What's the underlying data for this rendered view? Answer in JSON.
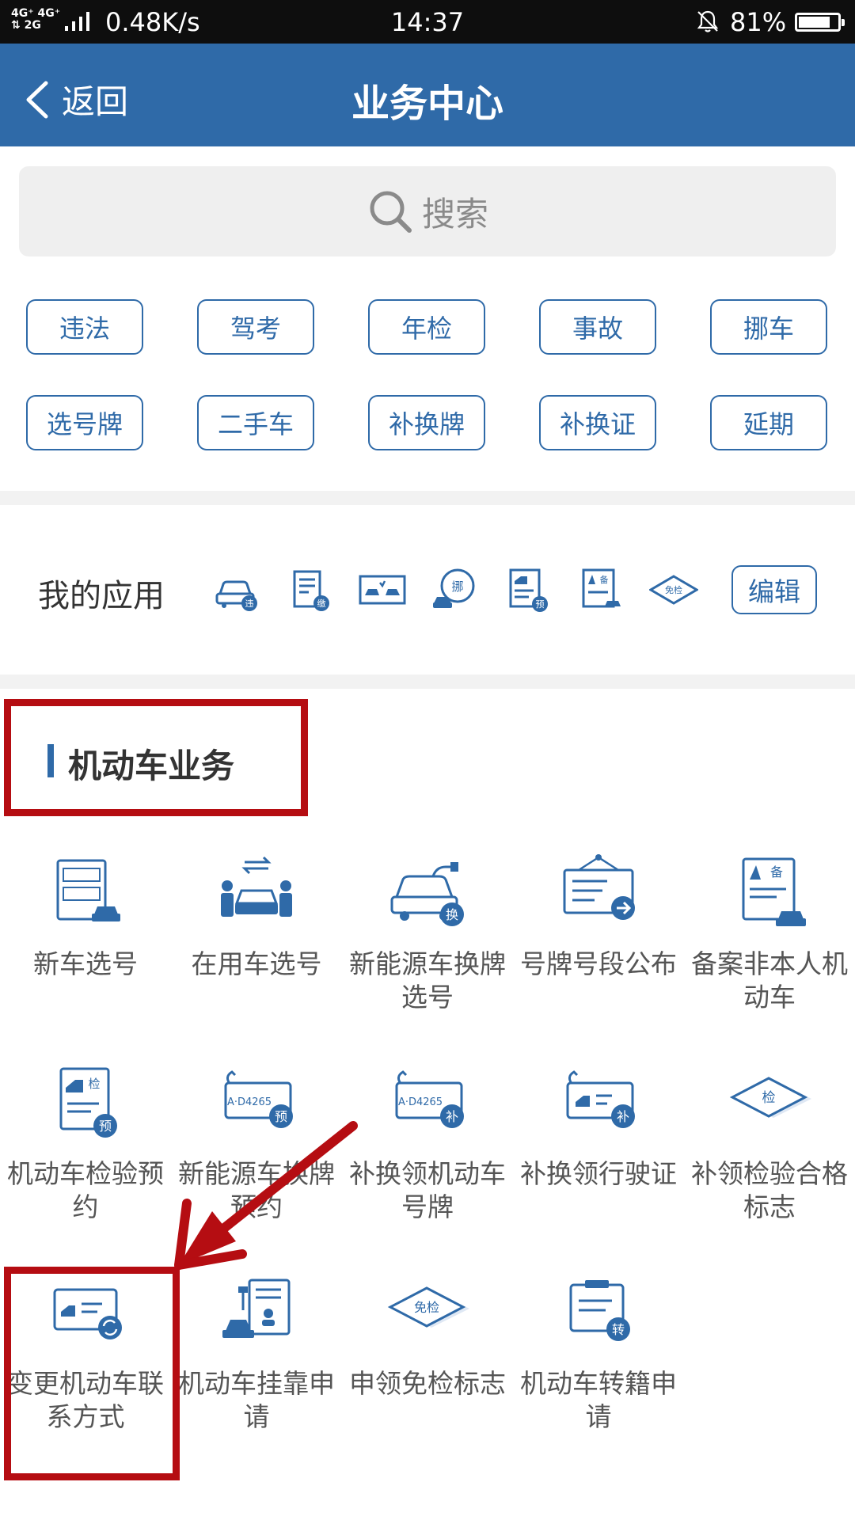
{
  "status_bar": {
    "network_top": "4G⁺ 4G⁺",
    "network_bottom": "⇅ 2G",
    "speed": "0.48K/s",
    "time": "14:37",
    "battery_percent": "81%",
    "battery_level": 0.81
  },
  "header": {
    "back_label": "返回",
    "title": "业务中心"
  },
  "search": {
    "placeholder": "搜索"
  },
  "tags": [
    "违法",
    "驾考",
    "年检",
    "事故",
    "挪车",
    "选号牌",
    "二手车",
    "补换牌",
    "补换证",
    "延期"
  ],
  "my_apps": {
    "label": "我的应用",
    "icons": [
      {
        "name": "car-violation-icon",
        "badge": "违"
      },
      {
        "name": "document-pay-icon",
        "badge": "缴"
      },
      {
        "name": "accident-scene-icon",
        "badge": ""
      },
      {
        "name": "move-car-icon",
        "badge": "挪"
      },
      {
        "name": "inspection-booking-icon",
        "badge": "预"
      },
      {
        "name": "filing-icon",
        "badge": "备"
      },
      {
        "name": "exempt-icon",
        "badge": "免检"
      }
    ],
    "edit_label": "编辑"
  },
  "section": {
    "title": "机动车业务"
  },
  "services": [
    {
      "name": "new-car-plate-select",
      "label": "新车选号",
      "badge": ""
    },
    {
      "name": "used-car-plate-select",
      "label": "在用车选号",
      "badge": ""
    },
    {
      "name": "new-energy-plate-select",
      "label": "新能源车换牌选号",
      "badge": "换"
    },
    {
      "name": "plate-segment-announce",
      "label": "号牌号段公布",
      "badge": ""
    },
    {
      "name": "filing-non-owner-vehicle",
      "label": "备案非本人机动车",
      "badge": "备"
    },
    {
      "name": "vehicle-inspection-booking",
      "label": "机动车检验预约",
      "badge": "预"
    },
    {
      "name": "new-energy-plate-booking",
      "label": "新能源车换牌预约",
      "badge": "预"
    },
    {
      "name": "replace-vehicle-plate",
      "label": "补换领机动车号牌",
      "badge": "补"
    },
    {
      "name": "replace-driving-license",
      "label": "补换领行驶证",
      "badge": "补"
    },
    {
      "name": "replace-inspection-mark",
      "label": "补领检验合格标志",
      "badge": "检"
    },
    {
      "name": "change-vehicle-contact",
      "label": "变更机动车联系方式",
      "badge": ""
    },
    {
      "name": "vehicle-affiliation-apply",
      "label": "机动车挂靠申请",
      "badge": ""
    },
    {
      "name": "apply-exempt-mark",
      "label": "申领免检标志",
      "badge": "免检"
    },
    {
      "name": "vehicle-transfer-apply",
      "label": "机动车转籍申请",
      "badge": "转"
    }
  ],
  "plate_text": "A·D4265",
  "colors": {
    "brand": "#2f6aa8",
    "annotation": "#b50d12"
  }
}
